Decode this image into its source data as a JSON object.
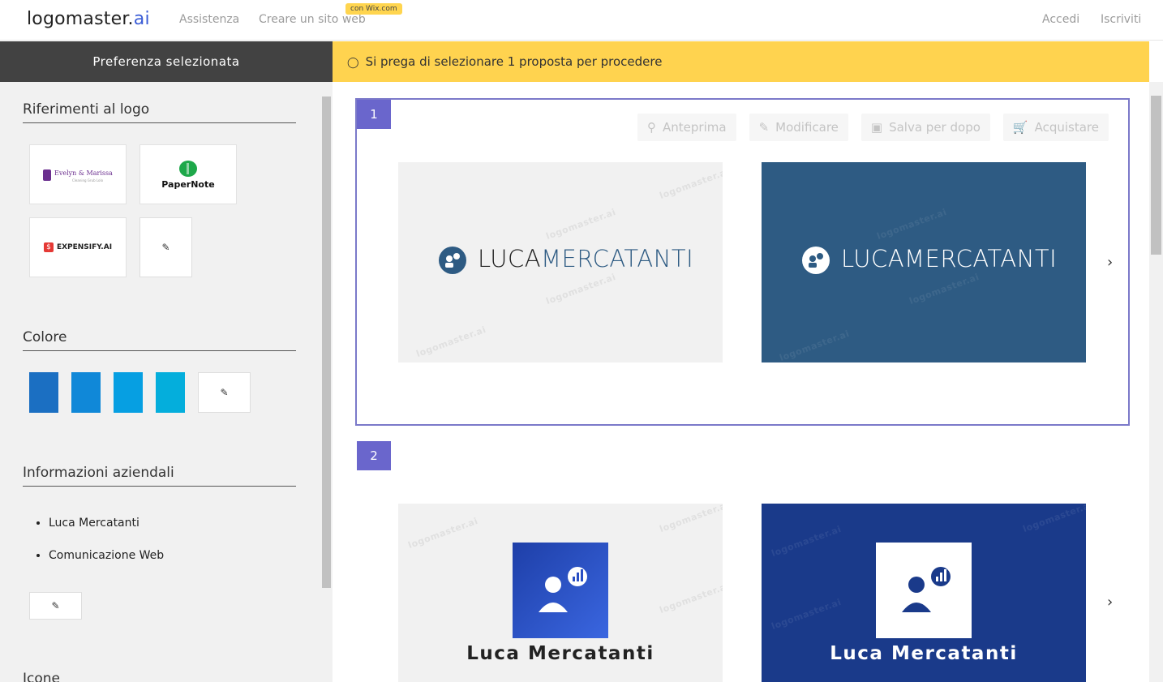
{
  "header": {
    "brand": "logomaster.",
    "brand_ai": "ai",
    "nav": [
      "Assistenza",
      "Creare un sito web"
    ],
    "wix_badge": "con Wix.com",
    "login": "Accedi",
    "signup": "Iscriviti"
  },
  "sidebar": {
    "title": "Preferenza selezionata",
    "references_title": "Riferimenti al logo",
    "references": [
      {
        "name": "Evelyn & Marissa",
        "sub": "Cleaning Grub Lolo"
      },
      {
        "name": "PaperNote"
      },
      {
        "name": "EXPENSIFY.AI"
      }
    ],
    "colors_title": "Colore",
    "colors": [
      "#1b6fc2",
      "#1088d8",
      "#069fe2",
      "#04aedc"
    ],
    "company_title": "Informazioni aziendali",
    "company_items": [
      "Luca Mercatanti",
      "Comunicazione Web"
    ],
    "icons_title": "Icone"
  },
  "alert": {
    "text": "Si prega di selezionare 1 proposta per procedere"
  },
  "proposals": [
    {
      "number": "1",
      "actions": [
        "Anteprima",
        "Modificare",
        "Salva per dopo",
        "Acquistare"
      ],
      "logo_first": "LUCA",
      "logo_second": "MERCATANTI"
    },
    {
      "number": "2",
      "logo_name": "Luca Mercatanti"
    }
  ],
  "watermark": "logomaster.ai",
  "colors": {
    "accent": "#6a66cc",
    "alert": "#ffd34f",
    "dark_header": "#424242",
    "card_blue": "#2e5b83",
    "card_navy": "#1a3a8a"
  }
}
